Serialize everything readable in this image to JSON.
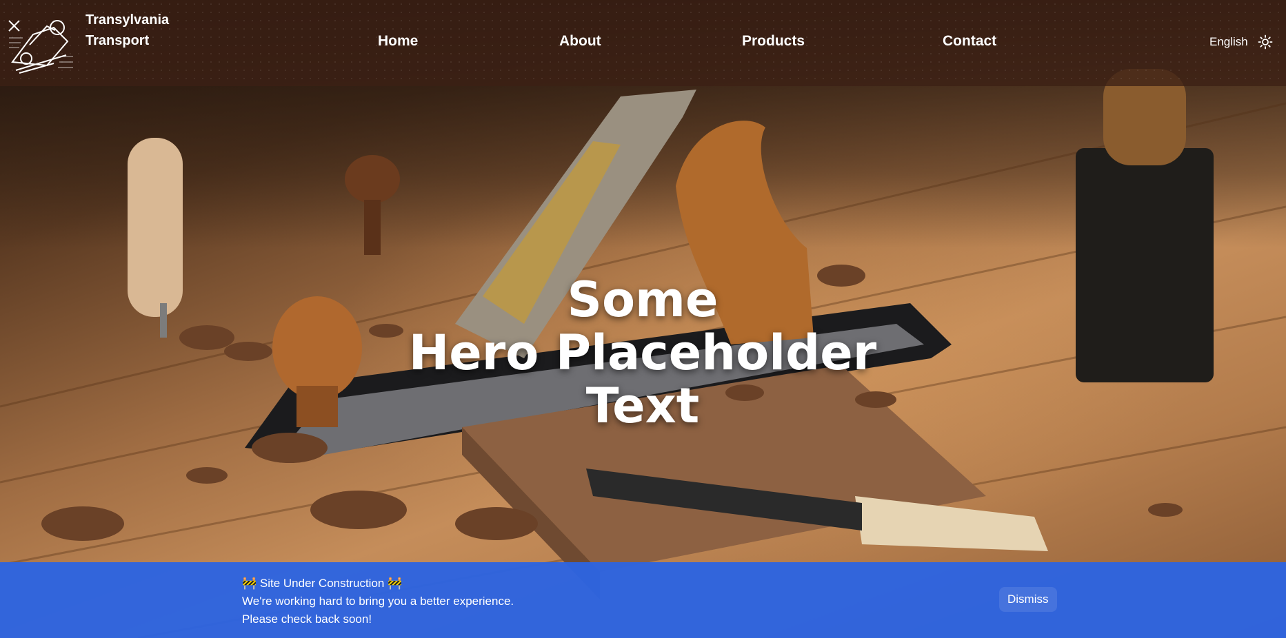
{
  "header": {
    "brand_line1": "Transylvania",
    "brand_line2": "Transport",
    "logo_icon": "woodworking-plane-logo-icon",
    "nav": [
      {
        "label": "Home"
      },
      {
        "label": "About"
      },
      {
        "label": "Products"
      },
      {
        "label": "Contact"
      }
    ],
    "language": "English",
    "theme_icon": "sun-icon"
  },
  "hero": {
    "title_line1": "Some",
    "title_line2": "Hero Placeholder",
    "title_line3": "Text",
    "background_image": "woodworking-hand-plane-on-workbench"
  },
  "banner": {
    "heading": "🚧 Site Under Construction 🚧",
    "line1": "We're working hard to bring you a better experience.",
    "line2": "Please check back soon!",
    "dismiss_label": "Dismiss"
  },
  "colors": {
    "header_bg": "#3c2014",
    "banner_bg": "#2d64e1",
    "text": "#ffffff"
  }
}
